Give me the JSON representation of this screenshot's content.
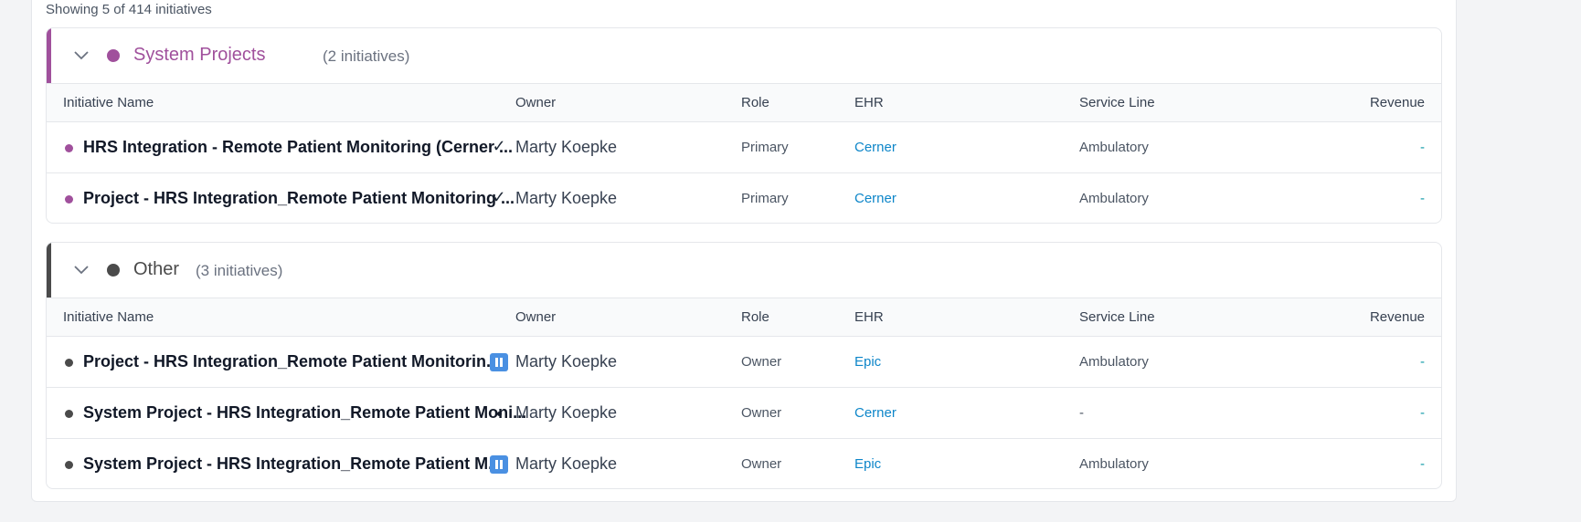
{
  "summary": "Showing 5 of 414 initiatives",
  "columns": {
    "name": "Initiative Name",
    "owner": "Owner",
    "role": "Role",
    "ehr": "EHR",
    "service_line": "Service Line",
    "revenue": "Revenue"
  },
  "groups": [
    {
      "title": "System Projects",
      "count": "(2 initiatives)",
      "color": "#a0509c",
      "rows": [
        {
          "name": "HRS Integration - Remote Patient Monitoring (Cerner ...",
          "status_icon": "check-icon",
          "status_glyph": "✓",
          "owner": "Marty Koepke",
          "role": "Primary",
          "ehr": "Cerner",
          "service_line": "Ambulatory",
          "revenue": "-"
        },
        {
          "name": "Project - HRS Integration_Remote Patient Monitoring ...",
          "status_icon": "check-icon",
          "status_glyph": "✓",
          "owner": "Marty Koepke",
          "role": "Primary",
          "ehr": "Cerner",
          "service_line": "Ambulatory",
          "revenue": "-"
        }
      ]
    },
    {
      "title": "Other",
      "count": "(3 initiatives)",
      "color": "#4b4b4b",
      "rows": [
        {
          "name": "Project - HRS Integration_Remote Patient Monitorin...",
          "status_icon": "pause-icon",
          "owner": "Marty Koepke",
          "role": "Owner",
          "ehr": "Epic",
          "service_line": "Ambulatory",
          "revenue": "-"
        },
        {
          "name": "System Project - HRS Integration_Remote Patient Moni...",
          "status_icon": "bullet-icon",
          "owner": "Marty Koepke",
          "role": "Owner",
          "ehr": "Cerner",
          "service_line": "-",
          "revenue": "-"
        },
        {
          "name": "System Project - HRS Integration_Remote Patient M...",
          "status_icon": "pause-icon",
          "owner": "Marty Koepke",
          "role": "Owner",
          "ehr": "Epic",
          "service_line": "Ambulatory",
          "revenue": "-"
        }
      ]
    }
  ]
}
